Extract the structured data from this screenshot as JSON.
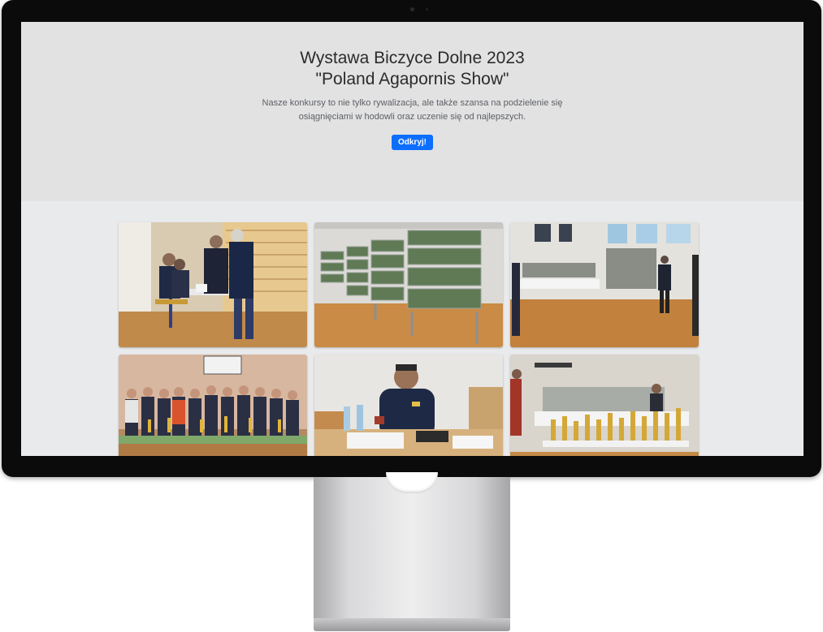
{
  "hero": {
    "title": "Wystawa Biczyce Dolne 2023",
    "subtitle": "\"Poland Agapornis Show\"",
    "lead": "Nasze konkursy to nie tylko rywalizacja, ale także szansa na podzielenie się osiągnięciami w hodowli oraz uczenie się od najlepszych.",
    "cta_label": "Odkryj!"
  },
  "colors": {
    "accent": "#0d6efd",
    "hero_background": "#e2e2e3",
    "page_background": "#e9eaec"
  },
  "gallery": {
    "photos": [
      {
        "description_icon": "photo-judges-icon"
      },
      {
        "description_icon": "photo-cages-icon"
      },
      {
        "description_icon": "photo-hall-icon"
      },
      {
        "description_icon": "photo-group-icon"
      },
      {
        "description_icon": "photo-judge-table-icon"
      },
      {
        "description_icon": "photo-trophies-icon"
      }
    ]
  }
}
